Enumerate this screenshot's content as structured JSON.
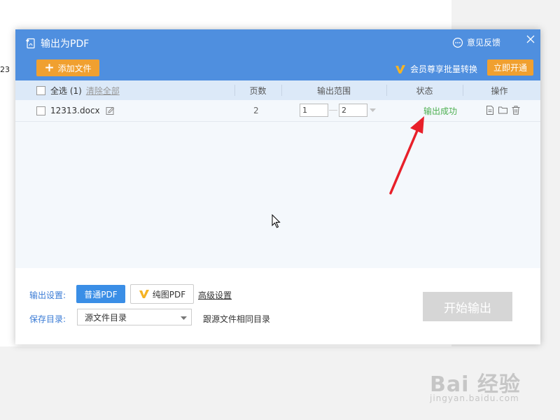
{
  "background": {
    "side_text": "23"
  },
  "dialog": {
    "title": "输出为PDF",
    "feedback_label": "意见反馈",
    "add_file_label": "添加文件",
    "vip_promo_label": "会员尊享批量转换",
    "open_now_label": "立即开通",
    "table": {
      "select_all_label": "全选 (1)",
      "clear_all_label": "清除全部",
      "columns": {
        "pages": "页数",
        "range": "输出范围",
        "status": "状态",
        "actions": "操作"
      },
      "rows": [
        {
          "file_name": "12313.docx",
          "pages": "2",
          "range_from": "1",
          "range_to": "2",
          "status": "输出成功"
        }
      ]
    },
    "footer": {
      "output_settings_label": "输出设置:",
      "normal_pdf_label": "普通PDF",
      "pure_image_pdf_label": "纯图PDF",
      "advanced_settings_label": "高级设置",
      "save_dir_label": "保存目录:",
      "save_dir_value": "源文件目录",
      "same_dir_note": "跟源文件相同目录",
      "start_label": "开始输出"
    }
  },
  "watermark": {
    "main": "Bai 经验",
    "sub": "jingyan.baidu.com"
  },
  "colors": {
    "header": "#4f8fdf",
    "accent_orange": "#f0a030",
    "success_green": "#4caf50",
    "annotation_arrow": "#e8202a"
  }
}
